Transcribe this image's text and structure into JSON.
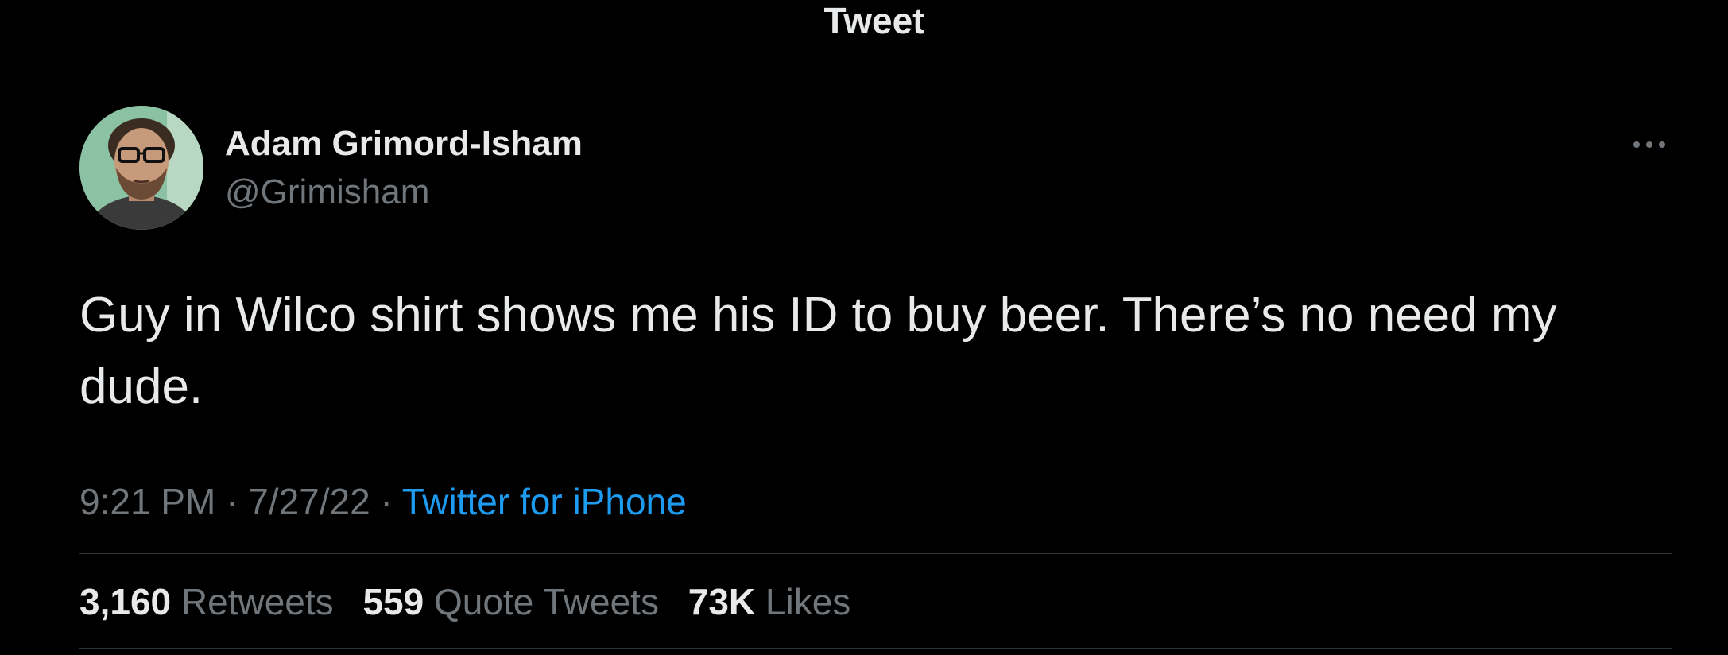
{
  "header": {
    "title": "Tweet"
  },
  "author": {
    "name": "Adam Grimord-Isham",
    "handle": "@Grimisham",
    "avatar_icon": "user-avatar-photo"
  },
  "tweet": {
    "text": "Guy in Wilco shirt shows me his ID to buy beer. There’s no need my dude.",
    "time": "9:21 PM",
    "separator": "·",
    "date": "7/27/22",
    "source": "Twitter for iPhone"
  },
  "stats": {
    "retweets_count": "3,160",
    "retweets_label": "Retweets",
    "quotes_count": "559",
    "quotes_label": "Quote Tweets",
    "likes_count": "73K",
    "likes_label": "Likes"
  },
  "icons": {
    "more": "more-horizontal-icon"
  },
  "colors": {
    "background": "#000000",
    "primary_text": "#e7e9ea",
    "secondary_text": "#71767b",
    "link": "#1d9bf0",
    "divider": "#2f3336"
  }
}
